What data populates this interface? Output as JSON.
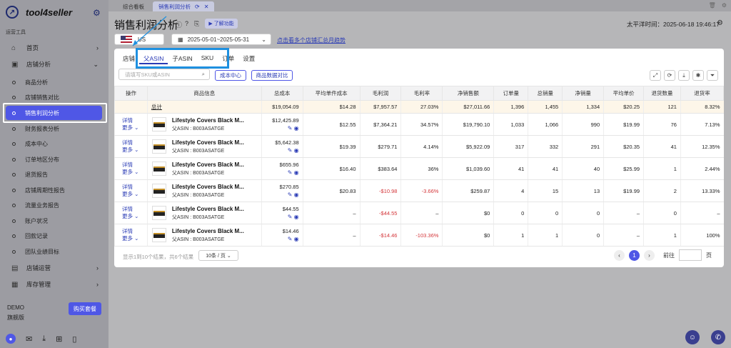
{
  "brand": "tool4seller",
  "sidebar": {
    "section_label": "运营工具",
    "items": [
      {
        "label": "首页",
        "icon": "home-icon"
      },
      {
        "label": "店铺分析",
        "icon": "shop-analysis-icon"
      }
    ],
    "subitems": [
      "商品分析",
      "店铺销售对比",
      "销售利润分析",
      "财务报表分析",
      "成本中心",
      "订单地区分布",
      "退货报告",
      "店铺周期性报告",
      "流量业务报告",
      "账户状况",
      "回款记录",
      "团队业绩目标"
    ],
    "groups": [
      {
        "label": "店铺运营"
      },
      {
        "label": "库存管理"
      }
    ],
    "account": "DEMO",
    "plan": "旗舰版",
    "buy_label": "购买套餐"
  },
  "tabs": {
    "home": "综合看板",
    "current": "销售利润分析"
  },
  "header": {
    "title": "销售利润分析",
    "learn_label": "了解功能",
    "timezone_label": "太平洋时间：2025-06-18 19:46:17",
    "country": "US",
    "date_range": "2025-05-01~2025-05-31",
    "link_text": "点击看多个店铺汇总月趋势"
  },
  "panel_tabs": [
    "店铺",
    "父ASIN",
    "子ASIN",
    "SKU",
    "订单",
    "设置"
  ],
  "search_placeholder": "请填写SKU或ASIN",
  "buttons": {
    "cost_center": "成本中心",
    "compare": "商品数据对比"
  },
  "table": {
    "headers": [
      "操作",
      "商品信息",
      "总成本",
      "平均单件成本",
      "毛利润",
      "毛利率",
      "净销售额",
      "订单量",
      "总销量",
      "净销量",
      "平均单价",
      "退货数量",
      "退货率"
    ],
    "summary": {
      "label": "总计",
      "values": [
        "$19,054.09",
        "$14.28",
        "$7,957.57",
        "27.03%",
        "$27,011.66",
        "1,396",
        "1,455",
        "1,334",
        "$20.25",
        "121",
        "8.32%"
      ]
    },
    "detail_label": "详情",
    "more_label": "更多",
    "rows": [
      {
        "name": "Lifestyle Covers Black M...",
        "asin": "父ASIN : B003ASATGE",
        "values": [
          "$12,425.89",
          "$12.55",
          "$7,364.21",
          "34.57%",
          "$19,790.10",
          "1,033",
          "1,066",
          "990",
          "$19.99",
          "76",
          "7.13%"
        ]
      },
      {
        "name": "Lifestyle Covers Black M...",
        "asin": "父ASIN : B003ASATGE",
        "values": [
          "$5,642.38",
          "$19.39",
          "$279.71",
          "4.14%",
          "$5,922.09",
          "317",
          "332",
          "291",
          "$20.35",
          "41",
          "12.35%"
        ]
      },
      {
        "name": "Lifestyle Covers Black M...",
        "asin": "父ASIN : B003ASATGE",
        "values": [
          "$655.96",
          "$16.40",
          "$383.64",
          "36%",
          "$1,039.60",
          "41",
          "41",
          "40",
          "$25.99",
          "1",
          "2.44%"
        ]
      },
      {
        "name": "Lifestyle Covers Black M...",
        "asin": "父ASIN : B003ASATGE",
        "values": [
          "$270.85",
          "$20.83",
          "-$10.98",
          "-3.66%",
          "$259.87",
          "4",
          "15",
          "13",
          "$19.99",
          "2",
          "13.33%"
        ]
      },
      {
        "name": "Lifestyle Covers Black M...",
        "asin": "父ASIN : B003ASATGE",
        "values": [
          "$44.55",
          "–",
          "-$44.55",
          "–",
          "$0",
          "0",
          "0",
          "0",
          "–",
          "0",
          "–"
        ]
      },
      {
        "name": "Lifestyle Covers Black M...",
        "asin": "父ASIN : B003ASATGE",
        "values": [
          "$14.46",
          "–",
          "-$14.46",
          "-103.36%",
          "$0",
          "1",
          "1",
          "0",
          "–",
          "1",
          "100%"
        ]
      }
    ]
  },
  "pagination": {
    "info": "显示1到10个结果，共6个结果",
    "page_size": "10条 / 页",
    "current": "1",
    "goto_label": "前往",
    "page_unit": "页"
  }
}
